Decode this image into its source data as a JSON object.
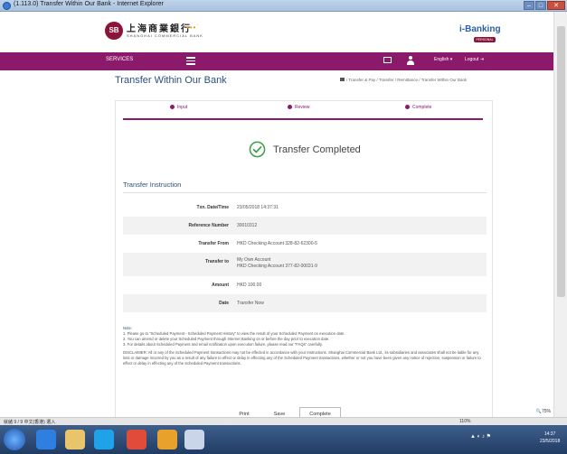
{
  "window": {
    "title": "(1.113.0) Transfer Within Our Bank - Internet Explorer"
  },
  "site": {
    "logo_cn": "上海商業銀行",
    "logo_en": "SHANGHAI COMMERCIAL BANK",
    "logo_mark": "SB",
    "ibanking": "i-Banking",
    "ibanking_badge": "PERSONAL"
  },
  "nav": {
    "services": "SERVICES",
    "language": "English ▾",
    "logout": "Logout"
  },
  "page": {
    "title": "Transfer Within Our Bank",
    "breadcrumb": "/ Transfer & Pay / Transfer / Remittance / Transfer Within Our Bank"
  },
  "steps": [
    {
      "label": "Input"
    },
    {
      "label": "Review"
    },
    {
      "label": "Complete"
    }
  ],
  "status": {
    "title": "Transfer Completed"
  },
  "instruction": {
    "heading": "Transfer Instruction",
    "rows": [
      {
        "label": "Txn. Date/Time",
        "value": "23/05/2018 14:37:31"
      },
      {
        "label": "Reference Number",
        "value": "30010312"
      },
      {
        "label": "Transfer From",
        "value": "HKD Checking Account 328-82-62300-5"
      },
      {
        "label": "Transfer to",
        "value": "My Own Account",
        "value2": "HKD Checking Account 377-82-00031-9"
      },
      {
        "label": "Amount",
        "value": "HKD 100.00"
      },
      {
        "label": "Date",
        "value": "Transfer Now"
      }
    ]
  },
  "notes": {
    "heading": "Note:",
    "items": [
      "1. Please go to \"Scheduled Payment - Scheduled Payment History\" to view the result of your Scheduled Payment on execution date.",
      "2. You can amend or delete your Scheduled Payment through Internet Banking on or before the day prior to execution date.",
      "3. For details about Scheduled Payment and email notification upon execution failure, please read our \"FAQs\" carefully."
    ],
    "disclaimer": "DISCLAIMER: All or any of the Scheduled Payment transactions may not be effected in accordance with your Instructions. Shanghai Commercial Bank Ltd., its subsidiaries and associates shall not be liable for any loss or damage incurred by you as a result of any failure to effect or delay in effecting any of the Scheduled Payment transactions, whether or not you have been given any notice of rejection, suspension or failure to effect or delay in effecting any of the Scheduled Payment transactions."
  },
  "actions": {
    "print": "Print",
    "save": "Save",
    "complete": "Complete"
  },
  "browser": {
    "zoom": "75%"
  },
  "ime": {
    "left": "就緒 9 / 9   中文(香港)   選入",
    "right": "110%"
  },
  "taskbar": {
    "time": "14:37",
    "date": "23/5/2018"
  },
  "colors": {
    "brand": "#8b1a6b",
    "title": "#2a4f7f",
    "success": "#3aa047"
  }
}
